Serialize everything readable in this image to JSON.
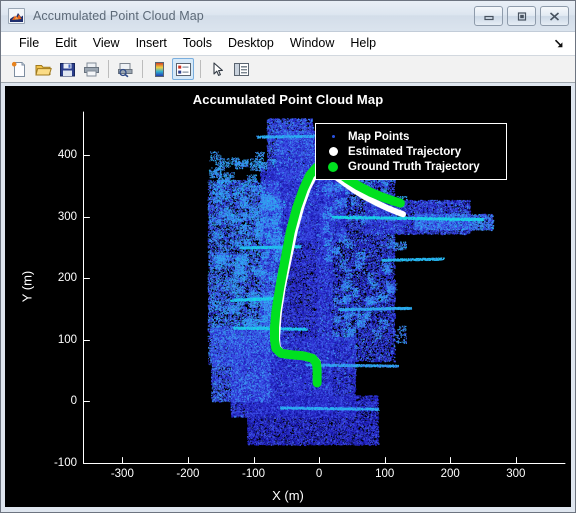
{
  "window": {
    "title": "Accumulated Point Cloud Map",
    "icon": "matlab-membrane-icon",
    "buttons": {
      "minimize": "minimize-button",
      "maximize": "maximize-button",
      "close": "close-button"
    }
  },
  "menubar": {
    "items": [
      {
        "label": "File"
      },
      {
        "label": "Edit"
      },
      {
        "label": "View"
      },
      {
        "label": "Insert"
      },
      {
        "label": "Tools"
      },
      {
        "label": "Desktop"
      },
      {
        "label": "Window"
      },
      {
        "label": "Help"
      }
    ],
    "dock_arrow": "↘"
  },
  "toolbar": {
    "buttons": [
      {
        "name": "new-figure-icon",
        "active": false
      },
      {
        "name": "open-file-icon",
        "active": false
      },
      {
        "name": "save-figure-icon",
        "active": false
      },
      {
        "name": "print-figure-icon",
        "active": false
      },
      {
        "name": "print-preview-icon",
        "active": false
      },
      {
        "name": "insert-colorbar-icon",
        "active": false
      },
      {
        "name": "insert-legend-icon",
        "active": true
      },
      {
        "name": "edit-plot-pointer-icon",
        "active": false
      },
      {
        "name": "show-plot-tools-icon",
        "active": false
      }
    ]
  },
  "chart_data": {
    "type": "scatter",
    "title": "Accumulated Point Cloud Map",
    "xlabel": "X (m)",
    "ylabel": "Y (m)",
    "xlim": [
      -360,
      375
    ],
    "ylim": [
      -100,
      470
    ],
    "xticks": [
      -300,
      -200,
      -100,
      0,
      100,
      200,
      300
    ],
    "yticks": [
      -100,
      0,
      100,
      200,
      300,
      400
    ],
    "xticklabels": [
      "-300",
      "-200",
      "-100",
      "0",
      "100",
      "200",
      "300"
    ],
    "yticklabels": [
      "-100",
      "0",
      "100",
      "200",
      "300",
      "400"
    ],
    "grid": false,
    "background": "#000000",
    "axis_color": "#ffffff",
    "legend": {
      "position": "top-right",
      "entries": [
        {
          "label": "Map Points",
          "color": "#2a52e0",
          "marker": "dot",
          "size": 3
        },
        {
          "label": "Estimated Trajectory",
          "color": "#ffffff",
          "marker": "dot",
          "size": 9
        },
        {
          "label": "Ground Truth Trajectory",
          "color": "#00e020",
          "marker": "dot",
          "size": 10
        }
      ]
    },
    "series": [
      {
        "name": "Map Points",
        "type": "pointcloud",
        "colormap": [
          "#1414a0",
          "#2828c8",
          "#3c50e6",
          "#3c8cf0",
          "#28b4f0",
          "#10e0e0"
        ],
        "description": "Dense accumulated lidar point cloud of an urban street scene, colored by height/intensity from deep blue to cyan."
      },
      {
        "name": "Ground Truth Trajectory",
        "type": "line",
        "color": "#00e020",
        "width": 9,
        "points": [
          [
            -3,
            30
          ],
          [
            -3,
            52
          ],
          [
            -4,
            62
          ],
          [
            -10,
            70
          ],
          [
            -24,
            74
          ],
          [
            -44,
            76
          ],
          [
            -58,
            78
          ],
          [
            -66,
            86
          ],
          [
            -68,
            100
          ],
          [
            -68,
            120
          ],
          [
            -66,
            145
          ],
          [
            -60,
            185
          ],
          [
            -52,
            230
          ],
          [
            -44,
            275
          ],
          [
            -34,
            315
          ],
          [
            -24,
            345
          ],
          [
            -14,
            368
          ],
          [
            -4,
            380
          ],
          [
            10,
            382
          ],
          [
            26,
            374
          ],
          [
            42,
            362
          ],
          [
            60,
            350
          ],
          [
            78,
            340
          ],
          [
            96,
            332
          ],
          [
            112,
            326
          ],
          [
            124,
            322
          ]
        ]
      },
      {
        "name": "Estimated Trajectory",
        "type": "line",
        "color": "#ffffff",
        "width": 6,
        "points": [
          [
            -1,
            30
          ],
          [
            -1,
            54
          ],
          [
            -2,
            64
          ],
          [
            -9,
            72
          ],
          [
            -23,
            76
          ],
          [
            -43,
            78
          ],
          [
            -57,
            80
          ],
          [
            -63,
            88
          ],
          [
            -64,
            102
          ],
          [
            -63,
            122
          ],
          [
            -61,
            147
          ],
          [
            -55,
            187
          ],
          [
            -46,
            232
          ],
          [
            -37,
            277
          ],
          [
            -27,
            316
          ],
          [
            -17,
            346
          ],
          [
            -7,
            367
          ],
          [
            4,
            375
          ],
          [
            18,
            370
          ],
          [
            34,
            358
          ],
          [
            52,
            344
          ],
          [
            70,
            332
          ],
          [
            88,
            322
          ],
          [
            104,
            314
          ],
          [
            118,
            308
          ],
          [
            128,
            304
          ]
        ]
      }
    ]
  }
}
